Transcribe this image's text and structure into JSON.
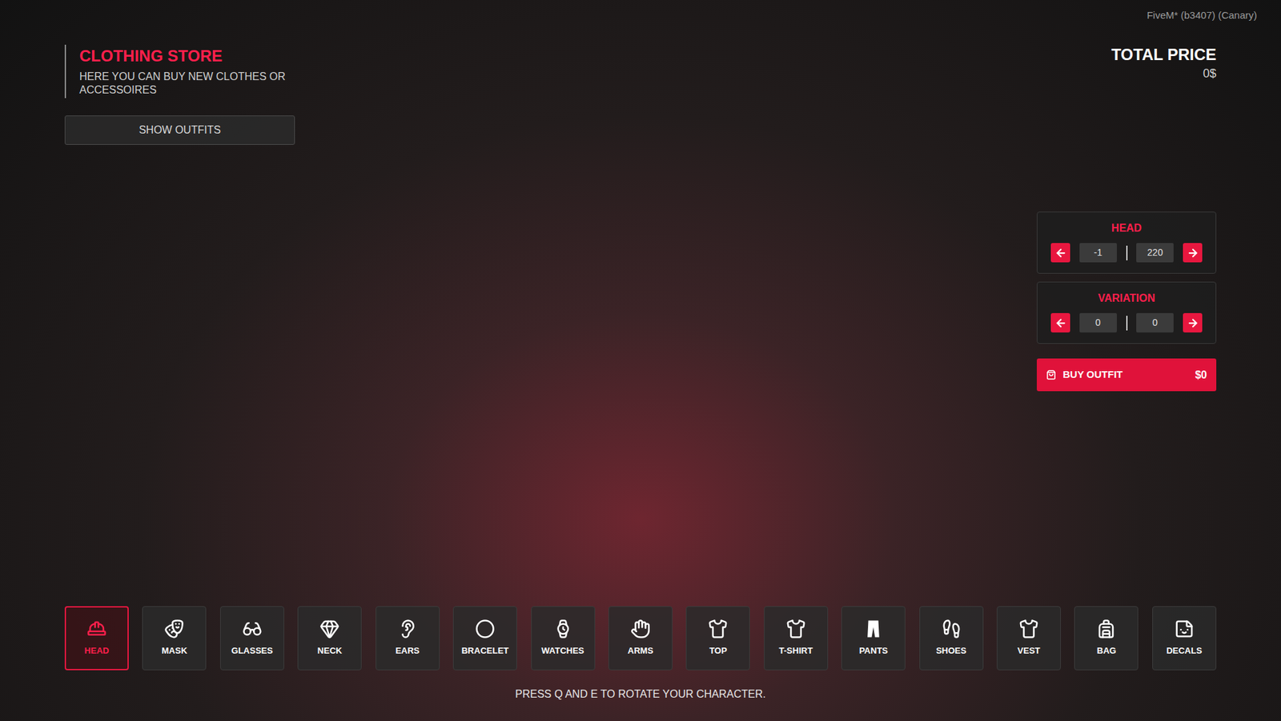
{
  "header": {
    "title": "CLOTHING STORE",
    "subtitle": "HERE YOU CAN BUY NEW CLOTHES OR ACCESSOIRES"
  },
  "show_outfits_button": "SHOW OUTFITS",
  "build_info": "FiveM* (b3407) (Canary)",
  "total_price": {
    "label": "TOTAL PRICE",
    "value": "0$"
  },
  "selectors": [
    {
      "label": "HEAD",
      "current": "-1",
      "max": "220"
    },
    {
      "label": "VARIATION",
      "current": "0",
      "max": "0"
    }
  ],
  "buy_button": {
    "label": "BUY OUTFIT",
    "price": "$0"
  },
  "categories": [
    {
      "label": "HEAD",
      "selected": true
    },
    {
      "label": "MASK",
      "selected": false
    },
    {
      "label": "GLASSES",
      "selected": false
    },
    {
      "label": "NECK",
      "selected": false
    },
    {
      "label": "EARS",
      "selected": false
    },
    {
      "label": "BRACELET",
      "selected": false
    },
    {
      "label": "WATCHES",
      "selected": false
    },
    {
      "label": "ARMS",
      "selected": false
    },
    {
      "label": "TOP",
      "selected": false
    },
    {
      "label": "T-SHIRT",
      "selected": false
    },
    {
      "label": "PANTS",
      "selected": false
    },
    {
      "label": "SHOES",
      "selected": false
    },
    {
      "label": "VEST",
      "selected": false
    },
    {
      "label": "BAG",
      "selected": false
    },
    {
      "label": "DECALS",
      "selected": false
    }
  ],
  "hint": "PRESS Q AND E TO ROTATE YOUR CHARACTER."
}
